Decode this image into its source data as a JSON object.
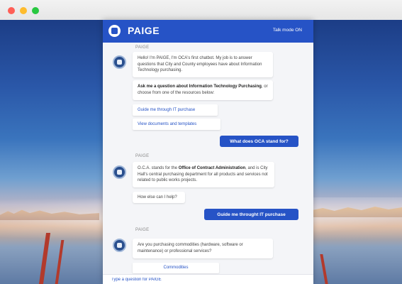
{
  "window": {
    "controls": [
      "close",
      "minimize",
      "zoom"
    ]
  },
  "header": {
    "title": "PAIGE",
    "mode": "Talk mode ON"
  },
  "conversation": {
    "msg1": {
      "sender": "PAIGE",
      "intro_text": "Hello! I'm PAIGE, I'm OCA's first chatbot. My job is to answer questions that City and County employees have about Information Technology purchasing.",
      "ask_bold": "Ask me a question about Information Technology Purchasing",
      "ask_rest": ", or choose from one of the resources below:",
      "option1": "Guide me through IT purchase",
      "option2": "View documents and templates"
    },
    "user1": "What does OCA stand for?",
    "msg2": {
      "sender": "PAIGE",
      "text_before": "O.C.A. stands for the ",
      "text_bold": "Office of Contract Administration",
      "text_after": ", and is City Hall's central purchasing department for all products and services not related to public works projects.",
      "followup": "How else can I help?"
    },
    "user2": "Guide me throught IT purchase",
    "msg3": {
      "sender": "PAIGE",
      "text": "Are you purchasing commodities (hardware, software or maintenance) or professional services?",
      "option1": "Commodities"
    }
  },
  "input": {
    "placeholder": "Type a question for PAIGE"
  },
  "colors": {
    "accent": "#2653c6",
    "panel": "#f4f5f8"
  }
}
